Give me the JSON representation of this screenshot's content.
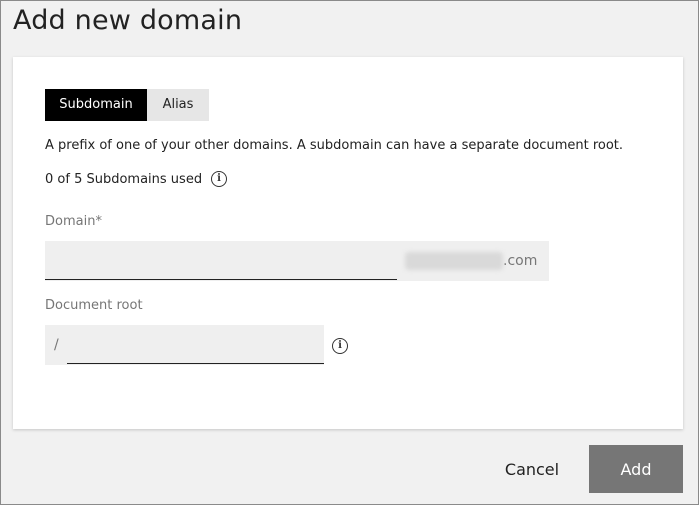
{
  "dialog": {
    "title": "Add new domain"
  },
  "tabs": [
    {
      "label": "Subdomain",
      "active": true
    },
    {
      "label": "Alias",
      "active": false
    }
  ],
  "description": "A prefix of one of your other domains. A subdomain can have a separate document root.",
  "usage": "0 of 5 Subdomains used",
  "domain_field": {
    "label": "Domain*",
    "value": "",
    "suffix": ".com"
  },
  "docroot_field": {
    "label": "Document root",
    "prefix": "/",
    "value": ""
  },
  "buttons": {
    "cancel": "Cancel",
    "add": "Add"
  },
  "icons": {
    "info": "i"
  }
}
